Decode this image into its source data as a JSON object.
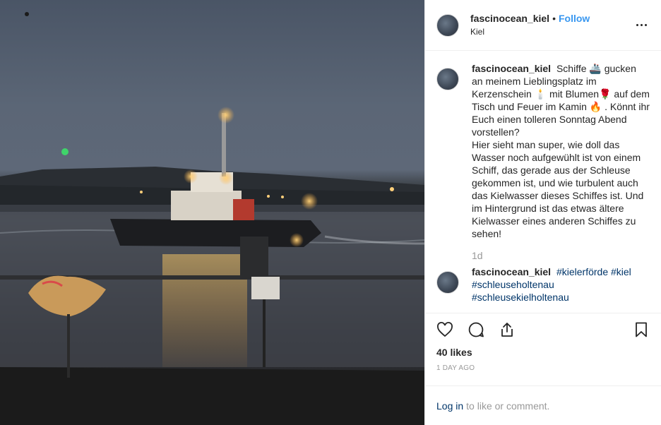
{
  "post": {
    "username": "fascinocean_kiel",
    "separator": "•",
    "follow_label": "Follow",
    "location": "Kiel",
    "caption": {
      "username": "fascinocean_kiel",
      "line1": "Schiffe 🚢 gucken an meinem Lieblingsplatz im Kerzenschein 🕯️ mit Blumen🌹 auf dem Tisch und Feuer im Kamin 🔥 . Könnt ihr Euch einen tolleren Sonntag Abend vorstellen?",
      "line2": "Hier sieht man super, wie doll das Wasser noch aufgewühlt ist von einem Schiff, das gerade aus der Schleuse gekommen ist, und wie turbulent auch das Kielwasser dieses Schiffes ist. Und im Hintergrund ist das etwas ältere Kielwasser eines anderen Schiffes zu sehen!",
      "time": "1d"
    },
    "hashtag_comment": {
      "username": "fascinocean_kiel",
      "tags": [
        "#kielerförde",
        "#kiel",
        "#schleuseholtenau",
        "#schleusekielholtenau"
      ]
    },
    "likes": "40 likes",
    "posted_ago": "1 DAY AGO",
    "login": {
      "link": "Log in",
      "text": "to like or comment."
    },
    "icons": {
      "more": "more-options-icon",
      "like": "heart-icon",
      "comment": "comment-icon",
      "share": "share-icon",
      "save": "bookmark-icon"
    },
    "colors": {
      "follow": "#3897f0",
      "link": "#003569",
      "muted": "#999999",
      "text": "#262626"
    }
  }
}
